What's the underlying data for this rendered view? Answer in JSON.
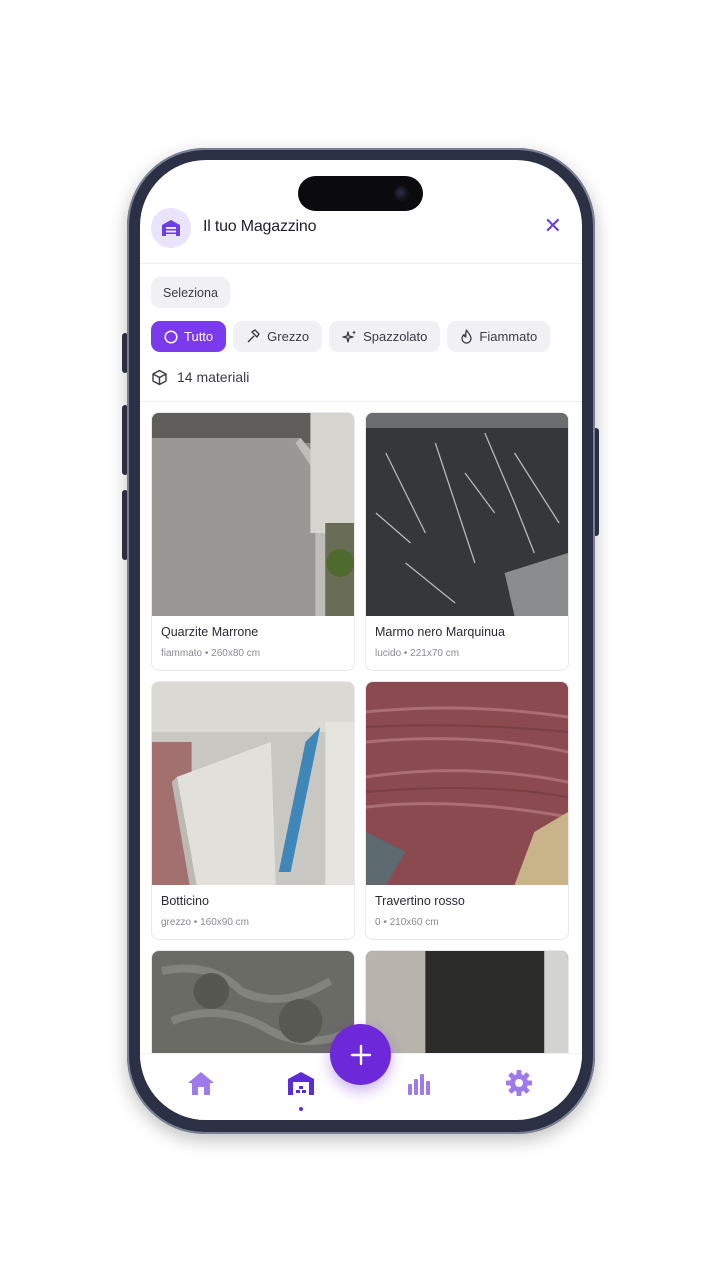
{
  "header": {
    "title": "Il tuo Magazzino"
  },
  "toolbar": {
    "select_label": "Seleziona"
  },
  "filters": [
    {
      "label": "Tutto",
      "icon": "circle-icon",
      "active": true
    },
    {
      "label": "Grezzo",
      "icon": "hammer-icon",
      "active": false
    },
    {
      "label": "Spazzolato",
      "icon": "sparkles-icon",
      "active": false
    },
    {
      "label": "Fiammato",
      "icon": "flame-icon",
      "active": false
    }
  ],
  "summary": {
    "count_label": "14 materiali"
  },
  "materials": [
    {
      "name": "Quarzite Marrone",
      "meta": "fiammato • 260x80 cm"
    },
    {
      "name": "Marmo nero Marquinua",
      "meta": "lucido • 221x70 cm"
    },
    {
      "name": "Botticino",
      "meta": "grezzo • 160x90 cm"
    },
    {
      "name": "Travertino rosso",
      "meta": "0 • 210x60 cm"
    },
    {
      "name": "",
      "meta": ""
    },
    {
      "name": "",
      "meta": ""
    }
  ],
  "nav": {
    "items": [
      "home-icon",
      "warehouse-icon",
      "chart-icon",
      "settings-icon"
    ],
    "active": "warehouse-icon"
  },
  "colors": {
    "accent": "#7c3aed",
    "accent_dark": "#6d28d9",
    "nav_icon": "#9f7aea"
  }
}
